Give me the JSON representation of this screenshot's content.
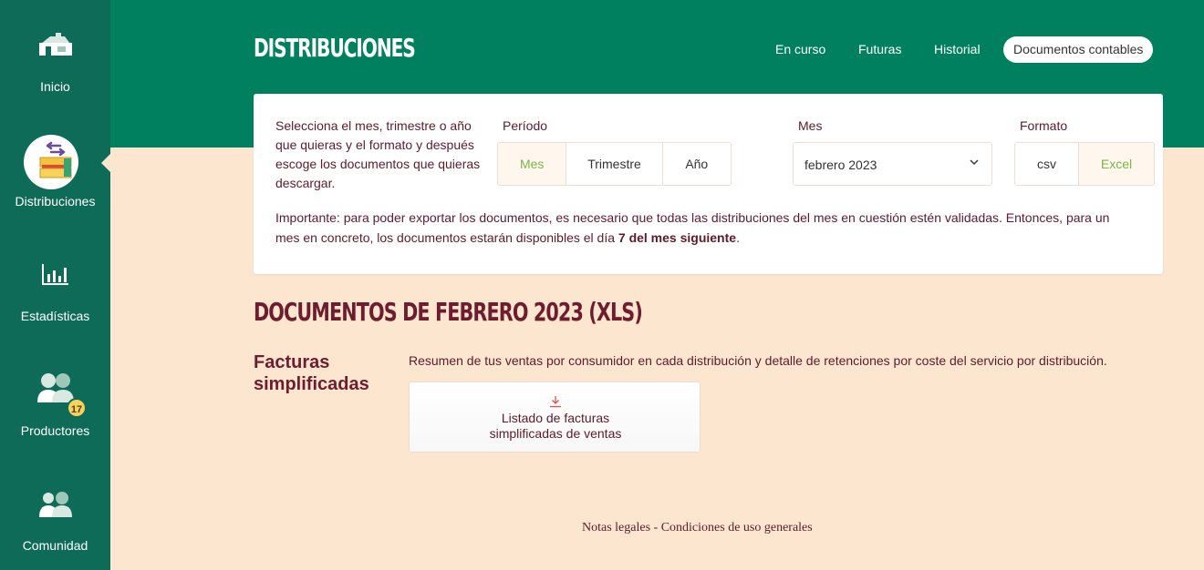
{
  "sidebar": {
    "items": [
      {
        "label": "Inicio",
        "icon": "house-icon"
      },
      {
        "label": "Distribuciones",
        "icon": "crates-icon"
      },
      {
        "label": "Estadísticas",
        "icon": "bar-chart-icon"
      },
      {
        "label": "Productores",
        "icon": "producers-icon",
        "badge": "17"
      },
      {
        "label": "Comunidad",
        "icon": "community-icon"
      }
    ],
    "active": "Distribuciones"
  },
  "header": {
    "title": "DISTRIBUCIONES",
    "tabs": [
      "En curso",
      "Futuras",
      "Historial",
      "Documentos contables"
    ],
    "active_tab": "Documentos contables"
  },
  "filters": {
    "intro": "Selecciona el mes, trimestre o año que quieras y el formato y después escoge los documentos que quieras descargar.",
    "period_label": "Período",
    "period_options": [
      "Mes",
      "Trimestre",
      "Año"
    ],
    "period_selected": "Mes",
    "month_label": "Mes",
    "month_value": "febrero 2023",
    "format_label": "Formato",
    "format_options": [
      "csv",
      "Excel"
    ],
    "format_selected": "Excel",
    "important_prefix": "Importante: para poder exportar los documentos, es necesario que todas las distribuciones del mes en cuestión estén validadas. Entonces, para un mes en concreto, los documentos estarán disponibles el día ",
    "important_bold": "7 del mes siguiente",
    "important_suffix": "."
  },
  "documents": {
    "title": "DOCUMENTOS DE FEBRERO 2023 (XLS)",
    "section_title": "Facturas simplificadas",
    "section_desc": "Resumen de tus ventas por consumidor en cada distribución y detalle de retenciones por coste del servicio por distribución.",
    "download_label_line1": "Listado de facturas",
    "download_label_line2": "simplificadas de ventas"
  },
  "footer": {
    "legal": "Notas legales",
    "separator": " - ",
    "terms": "Condiciones de uso generales"
  },
  "colors": {
    "sidebar": "#0e6b58",
    "header": "#00805f",
    "background": "#fde6d0",
    "text": "#5c1b2c",
    "accent_green": "#7ab648"
  }
}
